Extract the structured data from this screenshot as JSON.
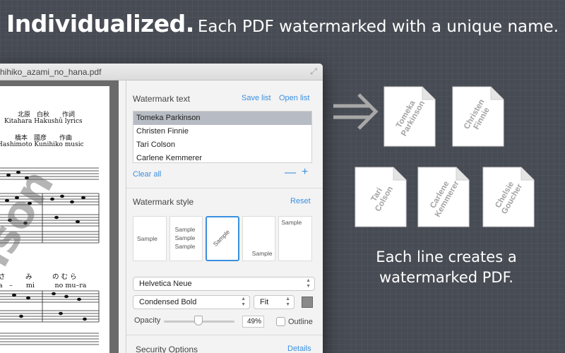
{
  "headline": {
    "strong": "Individualized.",
    "rest": "Each PDF watermarked with a unique name."
  },
  "window": {
    "title": "hihiko_azami_no_hana.pdf",
    "expand_icon": "expand-icon"
  },
  "score": {
    "author_line1": "北原　白秋　　作詞",
    "author_line2": "Kitahara Hakushû  lyrics",
    "composer_line1": "橋本　國彦　　作曲",
    "composer_line2": "Hashimoto Kunihiko  music",
    "lyrics_kana": "さ　　　み　　　の む ら",
    "lyrics_romaji": "a　–　　mi　　　no mu–ra",
    "watermark_text": "lson"
  },
  "watermark_text": {
    "label": "Watermark text",
    "save_list": "Save list",
    "open_list": "Open list",
    "names": [
      "Tomeka Parkinson",
      "Christen Finnie",
      "Tari Colson",
      "Carlene Kemmerer"
    ],
    "selected_index": 0,
    "clear_all": "Clear all",
    "minus": "—",
    "plus": "+"
  },
  "watermark_style": {
    "label": "Watermark style",
    "reset": "Reset",
    "samples": [
      {
        "text": "Sample"
      },
      {
        "lines": [
          "Sample",
          "Sample",
          "Sample"
        ]
      },
      {
        "text": "Sample"
      },
      {
        "text": "Sample"
      },
      {
        "text": "Sample"
      }
    ],
    "selected_index": 2
  },
  "font": {
    "family": "Helvetica Neue",
    "style": "Condensed Bold",
    "size": "Fit",
    "color": "#8a8a8a"
  },
  "opacity": {
    "label": "Opacity",
    "value": "49%",
    "fraction": 0.49,
    "outline_label": "Outline",
    "outline_checked": false
  },
  "security": {
    "label": "Security Options",
    "details": "Details"
  },
  "documents": [
    {
      "lines": [
        "Tomeka",
        "Parkinson"
      ]
    },
    {
      "lines": [
        "Christen",
        "Finnie"
      ]
    },
    {
      "lines": [
        "Tari",
        "Colson"
      ]
    },
    {
      "lines": [
        "Carlene",
        "Kemmerer"
      ]
    },
    {
      "lines": [
        "Chelsie",
        "Goucher"
      ]
    }
  ],
  "caption": {
    "line1": "Each line creates a",
    "line2": "watermarked PDF."
  }
}
